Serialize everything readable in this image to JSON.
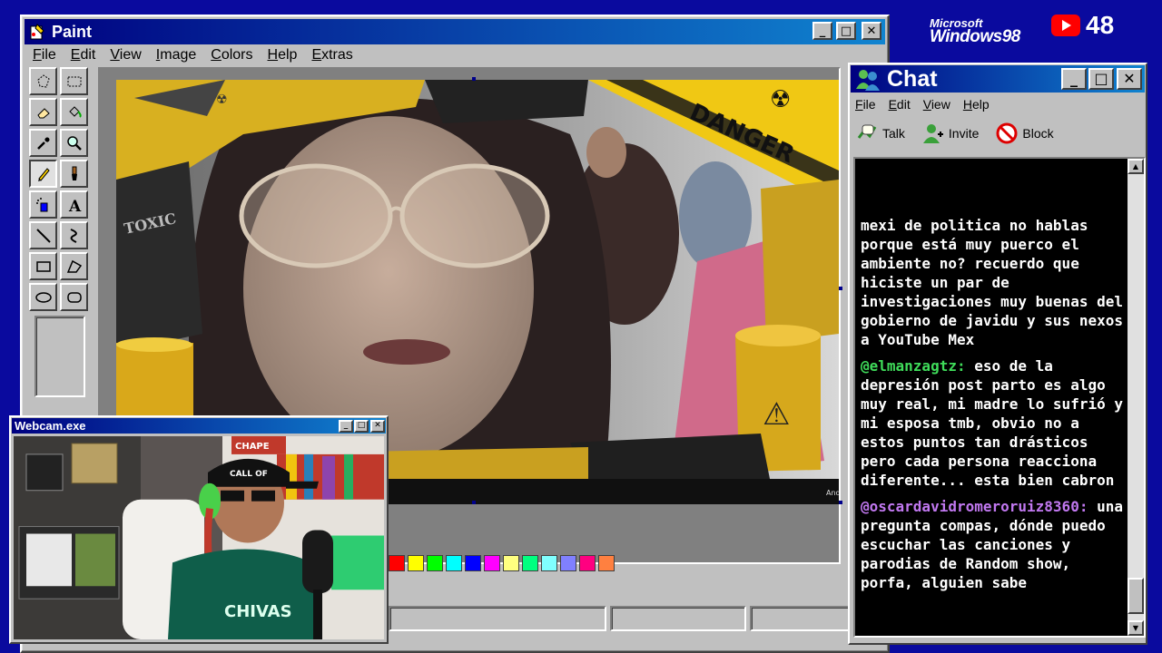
{
  "paint": {
    "title": "Paint",
    "menu": [
      "File",
      "Edit",
      "View",
      "Image",
      "Colors",
      "Help",
      "Extras"
    ],
    "tools": [
      "free-select",
      "rect-select",
      "eraser",
      "fill",
      "color-picker",
      "magnifier",
      "pencil",
      "brush",
      "airbrush",
      "text",
      "line",
      "curve",
      "rectangle",
      "polygon",
      "ellipse",
      "rounded-rect"
    ],
    "active_tool": "pencil",
    "canvas_caption": "Andy",
    "image": {
      "banner_text": "DANGER",
      "barrel_text": "TOXIC"
    },
    "palette": [
      "#ff0000",
      "#ffff00",
      "#00ff00",
      "#00ffff",
      "#0000ff",
      "#ff00ff",
      "#ffff80",
      "#00ff80",
      "#80ffff",
      "#8080ff",
      "#ff0080",
      "#ff8040"
    ]
  },
  "webcam": {
    "title": "Webcam.exe",
    "cap_text": "CALL OF",
    "shirt_text": "CHIVAS",
    "banner_text": "CHAPE"
  },
  "chat": {
    "title": "Chat",
    "menu": [
      "File",
      "Edit",
      "View",
      "Help"
    ],
    "toolbar": {
      "talk": "Talk",
      "invite": "Invite",
      "block": "Block"
    },
    "messages": [
      {
        "user": "",
        "text": "mexi de politica no hablas porque está muy puerco el ambiente no? recuerdo que hiciste un par de investigaciones muy buenas del gobierno de javidu y sus nexos a YouTube Mex"
      },
      {
        "user": "@elmanzagtz:",
        "text": "eso de la depresión post parto es algo muy real, mi madre lo sufrió y mi esposa tmb, obvio no a estos puntos tan drásticos pero cada persona reacciona diferente... esta bien cabron"
      },
      {
        "user": "@oscardavidromeroruiz8360:",
        "text": "una pregunta compas, dónde puedo escuchar las canciones y parodias de Random show, porfa, alguien sabe"
      }
    ]
  },
  "branding": {
    "microsoft": "Microsoft",
    "windows": "Windows98",
    "yt_count": "48"
  },
  "colors": {
    "desktop": "#0a0a9e",
    "titlebar": "#000080",
    "chat_user_green": "#3fdc5a",
    "chat_user_purple": "#c178f0"
  }
}
